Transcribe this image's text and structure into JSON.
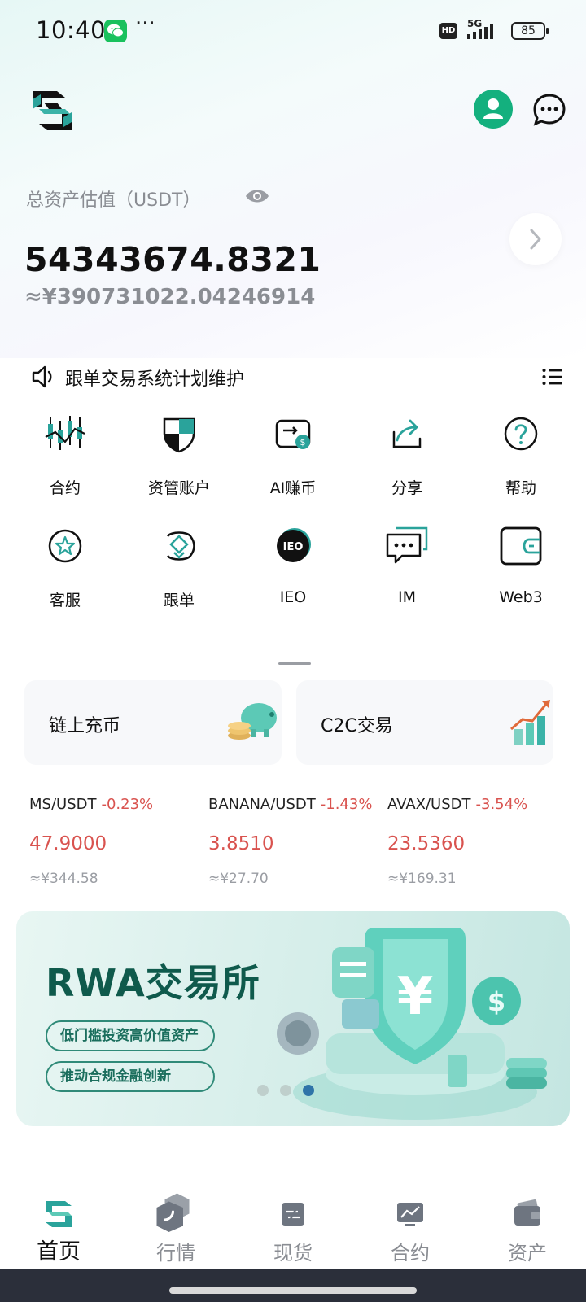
{
  "status_bar": {
    "time": "10:40",
    "more": "···",
    "hd": "HD",
    "network": "5G",
    "battery": "85"
  },
  "assets": {
    "label": "总资产估值（USDT）",
    "value": "54343674.8321",
    "cny": "≈¥390731022.04246914"
  },
  "announcement": {
    "text": "跟单交易系统计划维护"
  },
  "quick_menu": [
    {
      "label": "合约",
      "icon": "candlestick-icon"
    },
    {
      "label": "资管账户",
      "icon": "shield-icon"
    },
    {
      "label": "AI赚币",
      "icon": "ai-earn-icon"
    },
    {
      "label": "分享",
      "icon": "share-icon"
    },
    {
      "label": "帮助",
      "icon": "help-icon"
    },
    {
      "label": "客服",
      "icon": "star-service-icon"
    },
    {
      "label": "跟单",
      "icon": "copy-trade-icon"
    },
    {
      "label": "IEO",
      "icon": "ieo-icon",
      "badge": "IEO"
    },
    {
      "label": "IM",
      "icon": "im-icon"
    },
    {
      "label": "Web3",
      "icon": "wallet-icon"
    }
  ],
  "promo_cards": [
    {
      "label": "链上充币",
      "icon": "piggy-bank-icon"
    },
    {
      "label": "C2C交易",
      "icon": "growth-chart-icon"
    }
  ],
  "tickers": [
    {
      "pair": "MS/USDT",
      "change": "-0.23%",
      "price": "47.9000",
      "cny": "≈¥344.58"
    },
    {
      "pair": "BANANA/USDT",
      "change": "-1.43%",
      "price": "3.8510",
      "cny": "≈¥27.70"
    },
    {
      "pair": "AVAX/USDT",
      "change": "-3.54%",
      "price": "23.5360",
      "cny": "≈¥169.31"
    }
  ],
  "banner": {
    "title": "RWA交易所",
    "tags": [
      "低门槛投资高价值资产",
      "推动合规金融创新"
    ],
    "currency_symbol": "¥",
    "coin_symbol": "$",
    "active_dot": 3,
    "dot_count": 3
  },
  "bottom_nav": [
    {
      "label": "首页",
      "icon": "home-logo-icon",
      "active": true
    },
    {
      "label": "行情",
      "icon": "market-icon",
      "active": false
    },
    {
      "label": "现货",
      "icon": "spot-icon",
      "active": false
    },
    {
      "label": "合约",
      "icon": "futures-icon",
      "active": false
    },
    {
      "label": "资产",
      "icon": "assets-wallet-icon",
      "active": false
    }
  ],
  "colors": {
    "brand": "#14b07e",
    "down": "#d9534f",
    "banner_text": "#0f5a4c",
    "muted": "#8a8d93"
  }
}
